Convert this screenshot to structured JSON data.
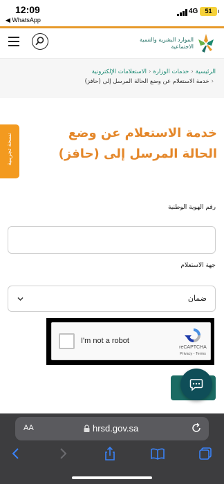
{
  "status_bar": {
    "time": "12:09",
    "back_label": "◀ WhatsApp",
    "network": "4G",
    "battery": "51"
  },
  "header": {
    "logo_text": "الموارد البشرية والتنمية الاجتماعية",
    "brand_color": "#1d6d62",
    "accent_color": "#e79a2b"
  },
  "breadcrumb": {
    "items": [
      "الرئيسية",
      "خدمات الوزارة",
      "الاستعلامات الإلكترونية"
    ],
    "current": "خدمة الاستعلام عن وضع الحالة المرسل إلى (حافز)"
  },
  "side_tab": {
    "label": "نسخة تجريبية"
  },
  "page_title": "خدمة الاستعلام عن وضع الحالة المرسل إلى (حافز)",
  "form": {
    "national_id_label": "رقم الهوية الوطنية",
    "national_id_value": "",
    "inquiry_label": "جهة الاستعلام",
    "inquiry_value": "ضمان"
  },
  "recaptcha": {
    "label": "I'm not a robot",
    "brand": "reCAPTCHA",
    "terms": "Privacy - Terms"
  },
  "safari": {
    "text_size": "AA",
    "host": "hrsd.gov.sa"
  },
  "icons": [
    "menu-icon",
    "search-icon",
    "chevron-down-icon",
    "recaptcha-logo-icon",
    "chat-icon",
    "lock-icon",
    "reload-icon",
    "back-icon",
    "forward-icon",
    "share-icon",
    "bookmarks-icon",
    "tabs-icon"
  ]
}
